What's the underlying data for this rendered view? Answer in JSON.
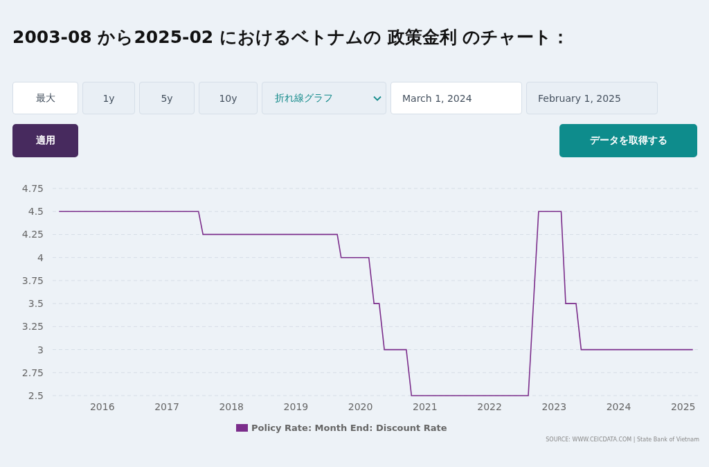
{
  "title": "2003-08 から2025-02 におけるベトナムの 政策金利 のチャート：",
  "range_tabs": [
    {
      "label": "最大",
      "selected": true
    },
    {
      "label": "1y",
      "selected": false
    },
    {
      "label": "5y",
      "selected": false
    },
    {
      "label": "10y",
      "selected": false
    }
  ],
  "chart_type_dropdown": {
    "value": "折れ線グラフ"
  },
  "date_fields": [
    {
      "value": "March 1, 2024",
      "focused": true
    },
    {
      "value": "February 1, 2025",
      "focused": false
    }
  ],
  "apply_button": "適用",
  "get_data_button": "データを取得する",
  "chart": {
    "chart_data": {
      "type": "line",
      "x": [
        2015.33,
        2017.49,
        2017.56,
        2019.64,
        2019.7,
        2020.13,
        2020.21,
        2020.29,
        2020.37,
        2020.71,
        2020.79,
        2022.6,
        2022.76,
        2023.11,
        2023.18,
        2023.34,
        2023.42,
        2025.15
      ],
      "series": [
        {
          "name": "Policy Rate: Month End: Discount Rate",
          "color": "#7b2d8b",
          "values": [
            4.5,
            4.5,
            4.25,
            4.25,
            4,
            4,
            3.5,
            3.5,
            3,
            3,
            2.5,
            2.5,
            4.5,
            4.5,
            3.5,
            3.5,
            3,
            3
          ]
        }
      ],
      "xlim": [
        2015.23,
        2025.25
      ],
      "ylim": [
        2.5,
        4.75
      ],
      "grid": true,
      "yticks": [
        {
          "value": 2.5,
          "label": "2.5"
        },
        {
          "value": 2.75,
          "label": "2.75"
        },
        {
          "value": 3,
          "label": "3"
        },
        {
          "value": 3.25,
          "label": "3.25"
        },
        {
          "value": 3.5,
          "label": "3.5"
        },
        {
          "value": 3.75,
          "label": "3.75"
        },
        {
          "value": 4,
          "label": "4"
        },
        {
          "value": 4.25,
          "label": "4.25"
        },
        {
          "value": 4.5,
          "label": "4.5"
        },
        {
          "value": 4.75,
          "label": "4.75"
        }
      ],
      "xticks": [
        {
          "value": 2016,
          "label": "2016"
        },
        {
          "value": 2017,
          "label": "2017"
        },
        {
          "value": 2018,
          "label": "2018"
        },
        {
          "value": 2019,
          "label": "2019"
        },
        {
          "value": 2020,
          "label": "2020"
        },
        {
          "value": 2021,
          "label": "2021"
        },
        {
          "value": 2022,
          "label": "2022"
        },
        {
          "value": 2023,
          "label": "2023"
        },
        {
          "value": 2024,
          "label": "2024"
        },
        {
          "value": 2025,
          "label": "2025"
        }
      ]
    },
    "source": "SOURCE: WWW.CEICDATA.COM | State Bank of Vietnam"
  }
}
